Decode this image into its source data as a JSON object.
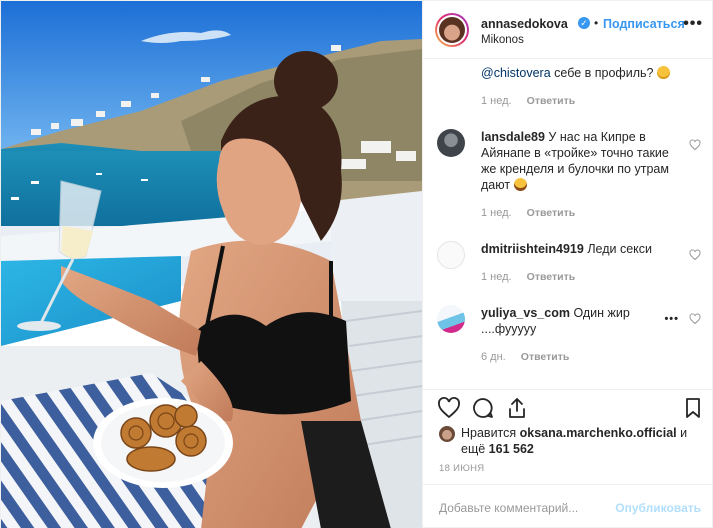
{
  "header": {
    "username": "annasedokova",
    "verified_mark": "✓",
    "separator": "•",
    "follow_label": "Подписаться",
    "location": "Mikonos",
    "more_icon": "more-horizontal-icon"
  },
  "comments": [
    {
      "mention": "@chistovera",
      "text": " себе в профиль?",
      "emoji": "thinking-face",
      "time": "1 нед.",
      "reply": "Ответить"
    },
    {
      "user": "lansdale89",
      "text": "У нас на Кипре в Айянапе в «тройке» точно такие же кренделя и булочки по утрам дают",
      "emoji": "grinning-face",
      "time": "1 нед.",
      "reply": "Ответить"
    },
    {
      "user": "dmitriishtein4919",
      "text": "Леди секси",
      "time": "1 нед.",
      "reply": "Ответить"
    },
    {
      "user": "yuliya_vs_com",
      "text": "Один жир ....фууууу",
      "time": "6 дн.",
      "reply": "Ответить",
      "options": "•••"
    }
  ],
  "likes": {
    "prefix": "Нравится ",
    "user": "oksana.marchenko.official",
    "middle": " и ещё ",
    "count": "161 562"
  },
  "date": "18 ИЮНЯ",
  "composer": {
    "placeholder": "Добавьте комментарий...",
    "publish_label": "Опубликовать"
  },
  "colors": {
    "accent": "#3897f0",
    "mention": "#003569",
    "muted": "#999999",
    "publish_disabled": "#b2dffc"
  }
}
